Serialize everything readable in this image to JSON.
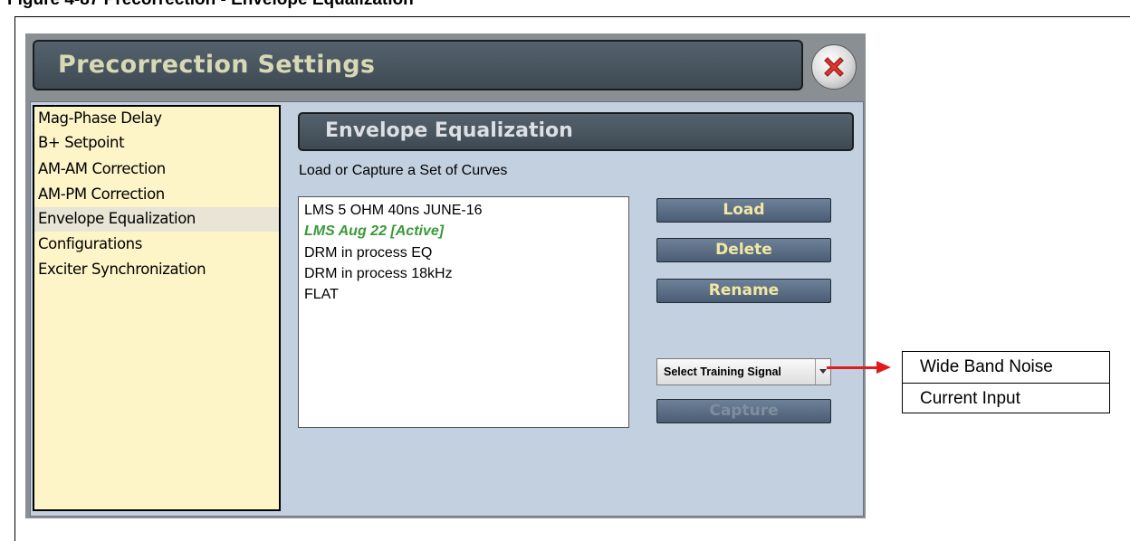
{
  "document": {
    "caption": "Figure 4-87 Precorrection - Envelope Equalization"
  },
  "window": {
    "title": "Precorrection Settings"
  },
  "sidebar": {
    "items": [
      {
        "label": "Mag-Phase Delay"
      },
      {
        "label": "B+ Setpoint"
      },
      {
        "label": "AM-AM Correction"
      },
      {
        "label": "AM-PM Correction"
      },
      {
        "label": "Envelope Equalization",
        "active": true
      },
      {
        "label": "Configurations"
      },
      {
        "label": "Exciter Synchronization"
      }
    ]
  },
  "main": {
    "header": "Envelope Equalization",
    "caption": "Load or Capture a Set of Curves",
    "curves": [
      {
        "label": "LMS 5 OHM 40ns JUNE-16"
      },
      {
        "label": "LMS Aug 22 [Active]",
        "active": true
      },
      {
        "label": "DRM in process EQ"
      },
      {
        "label": "DRM in process 18kHz"
      },
      {
        "label": "FLAT"
      }
    ],
    "buttons": {
      "load": "Load",
      "delete": "Delete",
      "rename": "Rename",
      "capture": "Capture"
    },
    "training_select": {
      "selected": "Select Training Signal"
    }
  },
  "callout": {
    "options": [
      "Wide Band Noise",
      "Current Input"
    ],
    "arrow_color": "#e11b1b"
  },
  "colors": {
    "title_text": "#d7d9b4",
    "button_text": "#f2e8a2",
    "active_curve": "#3a9a3a",
    "sidebar_bg": "#fdf5c8",
    "panel_bg": "#c3d0df"
  },
  "icons": {
    "close": "close-x-icon"
  }
}
